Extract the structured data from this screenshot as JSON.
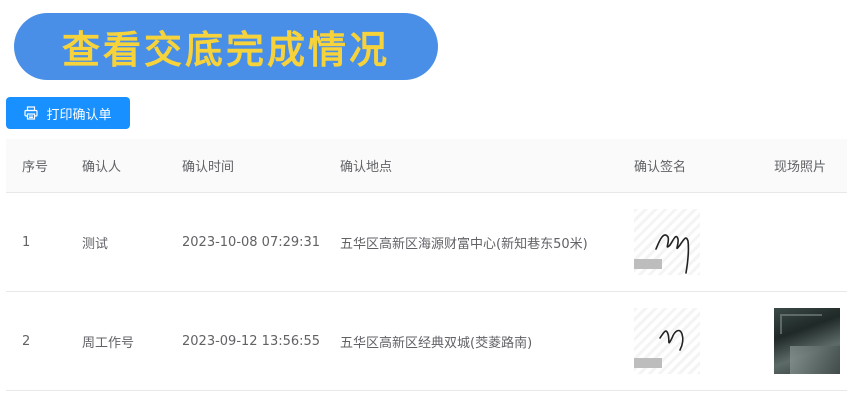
{
  "header": {
    "title": "查看交底完成情况"
  },
  "toolbar": {
    "print_label": "打印确认单",
    "print_icon": "printer-icon"
  },
  "table": {
    "columns": [
      "序号",
      "确认人",
      "确认时间",
      "确认地点",
      "确认签名",
      "现场照片"
    ],
    "rows": [
      {
        "index": "1",
        "confirmer": "测试",
        "time": "2023-10-08 07:29:31",
        "location": "五华区高新区海源财富中心(新知巷东50米)",
        "has_signature": true,
        "has_photo": false
      },
      {
        "index": "2",
        "confirmer": "周工作号",
        "time": "2023-09-12 13:56:55",
        "location": "五华区高新区经典双城(茭菱路南)",
        "has_signature": true,
        "has_photo": true
      }
    ]
  },
  "colors": {
    "title_bg": "#4a8fe7",
    "title_text": "#f6d23b",
    "button_bg": "#1890ff"
  }
}
